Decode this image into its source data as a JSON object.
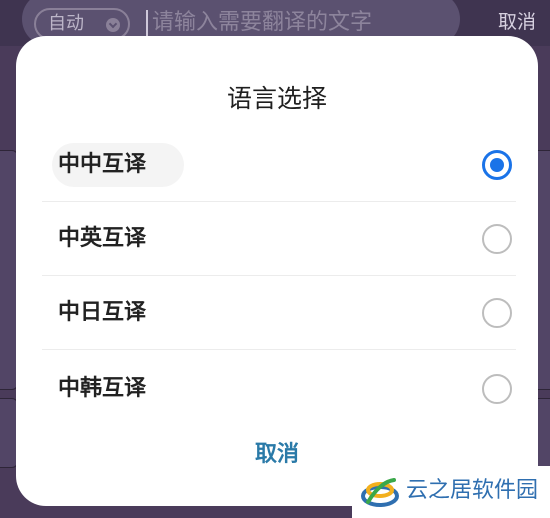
{
  "topbar": {
    "language_chip": "自动",
    "search_placeholder": "请输入需要翻译的文字",
    "cancel_label": "取消"
  },
  "dialog": {
    "title": "语言选择",
    "options": [
      {
        "label": "中中互译",
        "selected": true
      },
      {
        "label": "中英互译",
        "selected": false
      },
      {
        "label": "中日互译",
        "selected": false
      },
      {
        "label": "中韩互译",
        "selected": false
      }
    ],
    "cancel_label": "取消"
  },
  "watermark": {
    "text": "云之居软件园"
  },
  "colors": {
    "accent": "#1a73e8",
    "cancel_text": "#2a7aa8",
    "watermark_text": "#2f6fb0"
  }
}
